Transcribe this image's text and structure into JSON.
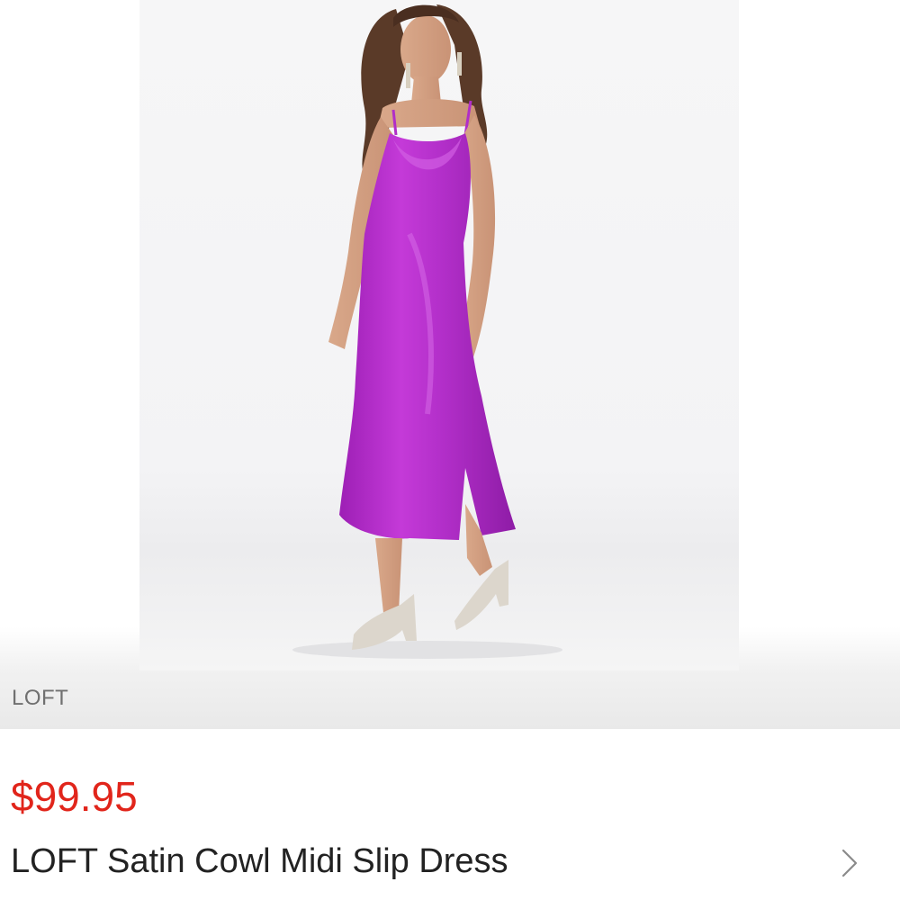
{
  "product": {
    "brand": "LOFT",
    "price": "$99.95",
    "title": "LOFT Satin Cowl Midi Slip Dress",
    "image_subject": "model-in-purple-satin-slip-dress"
  },
  "colors": {
    "price": "#e1251b",
    "dress": "#b12ec8",
    "title": "#222222",
    "brand_label": "#707070"
  },
  "icons": {
    "detail_arrow": "chevron-right-icon"
  }
}
